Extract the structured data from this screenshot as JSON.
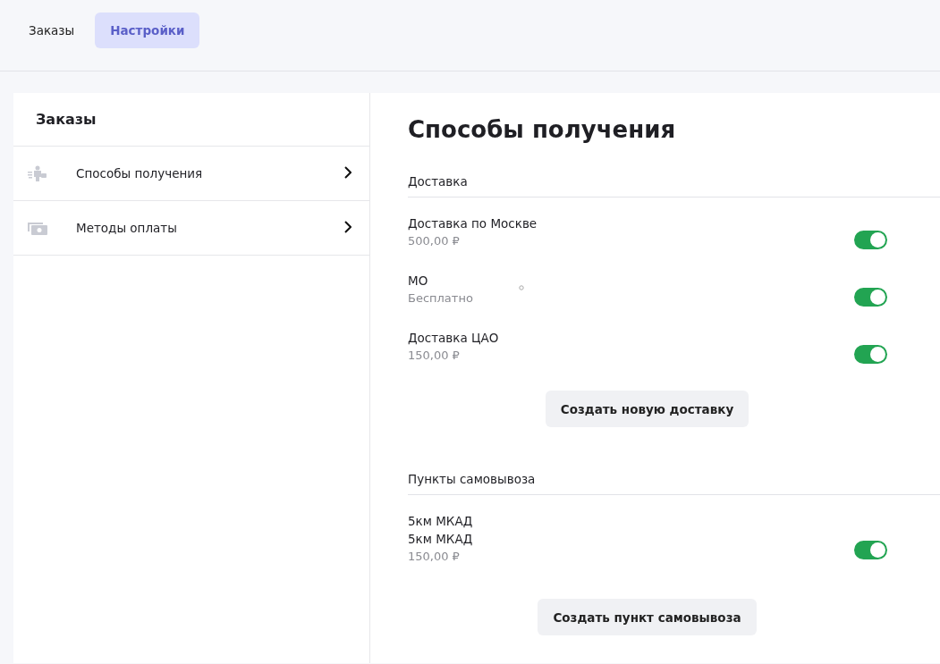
{
  "tabs": [
    {
      "label": "Заказы",
      "selected": false
    },
    {
      "label": "Настройки",
      "selected": true
    }
  ],
  "sidebar": {
    "title": "Заказы",
    "items": [
      {
        "label": "Способы получения"
      },
      {
        "label": "Методы оплаты"
      }
    ]
  },
  "page_title": "Способы получения",
  "sections": [
    {
      "title": "Доставка",
      "items": [
        {
          "lines": [
            "Доставка по Москве"
          ],
          "price": "500,00 ₽",
          "enabled": true
        },
        {
          "lines": [
            "МО"
          ],
          "price": "Бесплатно",
          "enabled": true,
          "mark": true
        },
        {
          "lines": [
            "Доставка ЦАО"
          ],
          "price": "150,00 ₽",
          "enabled": true
        }
      ],
      "button": "Создать новую доставку"
    },
    {
      "title": "Пункты самовывоза",
      "items": [
        {
          "lines": [
            "5км МКАД",
            "5км МКАД"
          ],
          "price": "150,00 ₽",
          "enabled": true
        }
      ],
      "button": "Создать пункт самовывоза"
    }
  ]
}
